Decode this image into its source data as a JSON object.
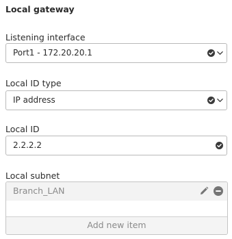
{
  "section": {
    "title": "Local gateway"
  },
  "listening_interface": {
    "label": "Listening interface",
    "value": "Port1 - 172.20.20.1"
  },
  "local_id_type": {
    "label": "Local ID type",
    "value": "IP address"
  },
  "local_id": {
    "label": "Local ID",
    "value": "2.2.2.2"
  },
  "local_subnet": {
    "label": "Local subnet",
    "items": [
      "Branch_LAN"
    ],
    "add_label": "Add new item"
  },
  "colors": {
    "icon_dark": "#3a3a3a",
    "icon_gray": "#757575",
    "border": "#b9b9b9",
    "muted_text": "#8a8a8a"
  },
  "icons": [
    "check-circle-icon",
    "chevron-down-icon",
    "pencil-icon",
    "minus-circle-icon"
  ]
}
